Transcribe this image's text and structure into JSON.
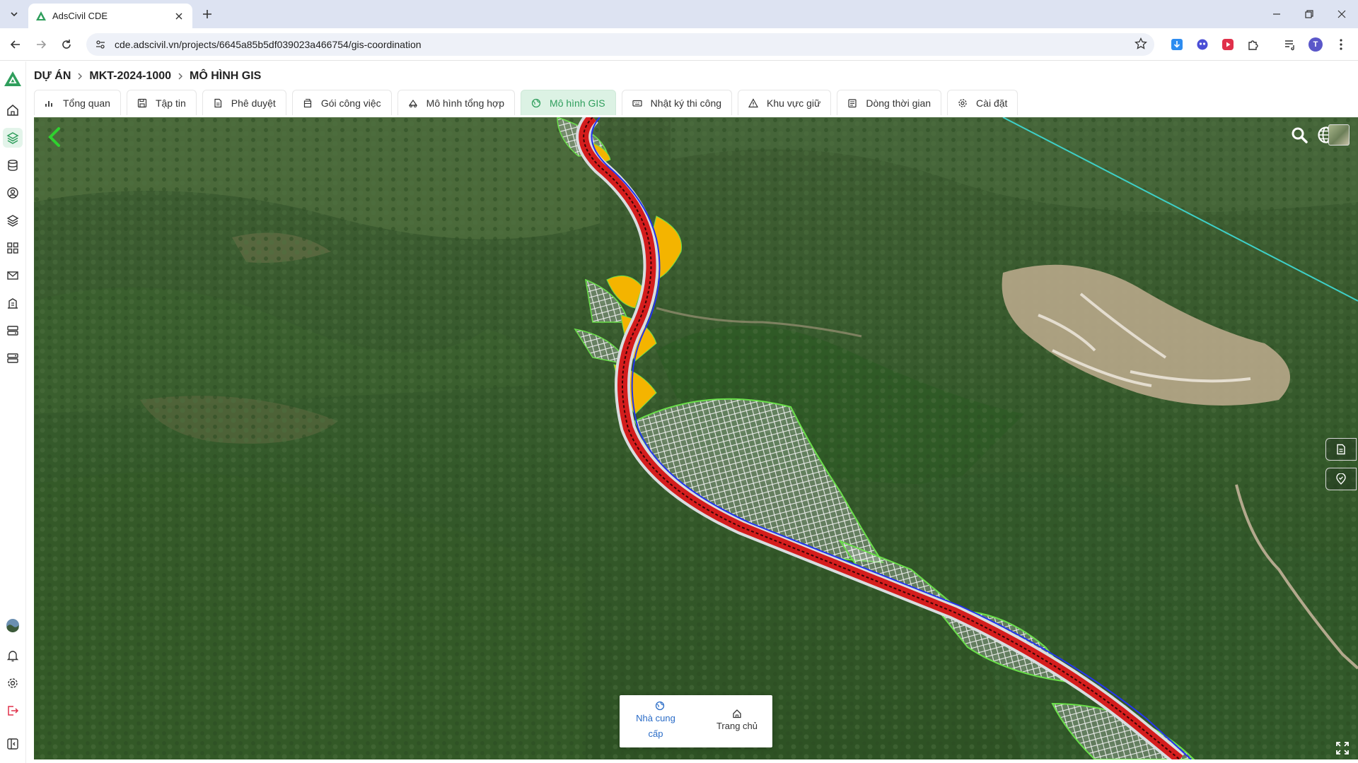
{
  "browser": {
    "tab_title": "AdsCivil CDE",
    "url": "cde.adscivil.vn/projects/6645a85b5df039023a466754/gis-coordination",
    "avatar_initial": "T"
  },
  "breadcrumb": {
    "root": "DỰ ÁN",
    "project": "MKT-2024-1000",
    "current": "MÔ HÌNH GIS"
  },
  "tabs": [
    {
      "label": "Tổng quan",
      "icon": "bar-chart-icon"
    },
    {
      "label": "Tập tin",
      "icon": "save-icon"
    },
    {
      "label": "Phê duyệt",
      "icon": "document-icon"
    },
    {
      "label": "Gói công việc",
      "icon": "package-icon"
    },
    {
      "label": "Mô hình tổng hợp",
      "icon": "model-icon"
    },
    {
      "label": "Mô hình GIS",
      "icon": "globe-icon",
      "active": true
    },
    {
      "label": "Nhật ký thi công",
      "icon": "keyboard-icon"
    },
    {
      "label": "Khu vực giữ",
      "icon": "warning-icon"
    },
    {
      "label": "Dòng thời gian",
      "icon": "calendar-icon"
    },
    {
      "label": "Cài đặt",
      "icon": "gear-icon"
    }
  ],
  "map": {
    "bottom_panel": {
      "provider_label": "Nhà cung cấp",
      "home_label": "Trang chủ"
    }
  },
  "colors": {
    "accent_green": "#2f9e5c",
    "active_tab_bg": "#dcf2e4",
    "road_red": "#d41d1d",
    "fill_yellow": "#f4b400",
    "link_blue": "#2a6cc7"
  }
}
